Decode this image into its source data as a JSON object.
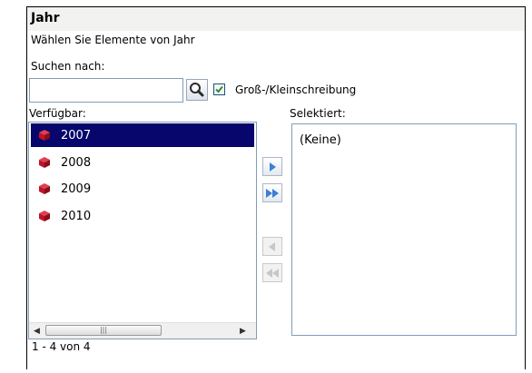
{
  "title": "Jahr",
  "subtitle": "Wählen Sie Elemente von Jahr",
  "search": {
    "label": "Suchen nach:",
    "value": "",
    "placeholder": ""
  },
  "case_sensitive": {
    "label": "Groß-/Kleinschreibung",
    "checked": true
  },
  "available": {
    "label": "Verfügbar:",
    "items": [
      {
        "label": "2007",
        "selected": true
      },
      {
        "label": "2008",
        "selected": false
      },
      {
        "label": "2009",
        "selected": false
      },
      {
        "label": "2010",
        "selected": false
      }
    ],
    "count_text": "1 - 4 von 4"
  },
  "selected": {
    "label": "Selektiert:",
    "empty_text": "(Keine)"
  },
  "colors": {
    "selection": "#06066d",
    "cube": "#c0122b",
    "arrow": "#3b7fd6"
  },
  "icons": {
    "search": "magnifier-icon",
    "member": "cube-icon"
  }
}
